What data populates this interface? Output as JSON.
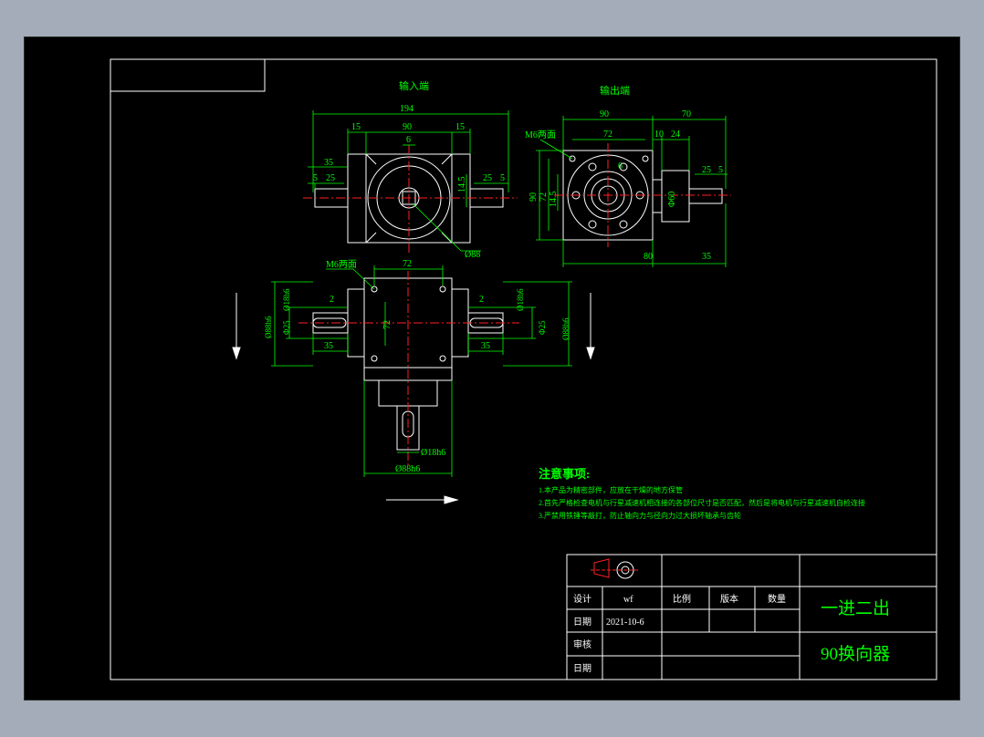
{
  "views": {
    "input_title": "输入端",
    "output_title": "输出端"
  },
  "dims": {
    "top_total": "194",
    "top_mid": "90",
    "top_left": "15",
    "top_right": "15",
    "top_center": "6",
    "top_35": "35",
    "top_l5": "5",
    "top_l25": "25",
    "top_r25": "25",
    "top_r5": "5",
    "top_145": "14.5",
    "top_phi": "Ø88",
    "out_90": "90",
    "out_70": "70",
    "out_72": "72",
    "out_10": "10",
    "out_24": "24",
    "out_m6": "M6两面",
    "out_6": "6",
    "out_25": "25",
    "out_5": "5",
    "out_v90": "90",
    "out_v72": "72",
    "out_v145": "14.5",
    "out_phi60": "Φ60",
    "out_80": "80",
    "out_35": "35",
    "bot_m6": "M6两面",
    "bot_72": "72",
    "bot_l2": "2",
    "bot_r2": "2",
    "bot_l18": "Ø18h6",
    "bot_r18": "Ø18h6",
    "bot_l88": "Ø88h6",
    "bot_r88": "Ø88h6",
    "bot_l35": "35",
    "bot_r35": "35",
    "bot_l25": "Φ25",
    "bot_r25": "Φ25",
    "bot_v72": "72",
    "bot_shaft18": "Ø18h6",
    "bot_base88": "Ø88h6"
  },
  "notes": {
    "title": "注意事项:",
    "line1": "1.本产品为精密部件，应放在干燥的地方保管",
    "line2": "2.首先严格检查电机与行星减速机相连接的各部位尺寸是否匹配，然后是将电机与行星减速机自检连接",
    "line3": "3.严禁用铁锤等敲打，防止轴向力与径向力过大损坏轴承与齿轮"
  },
  "title_block": {
    "design_label": "设计",
    "design_value": "wf",
    "date_label": "日期",
    "date_value": "2021-10-6",
    "review_label": "审核",
    "date2_label": "日期",
    "scale_label": "比例",
    "version_label": "版本",
    "qty_label": "数量",
    "name1": "一进二出",
    "name2": "90换向器"
  },
  "colors": {
    "background": "#a3acb8",
    "sheet": "#000000",
    "line_white": "#ffffff",
    "dim_green": "#00ff00",
    "center_red": "#ff2020",
    "text_yellow": "#ffff00"
  }
}
